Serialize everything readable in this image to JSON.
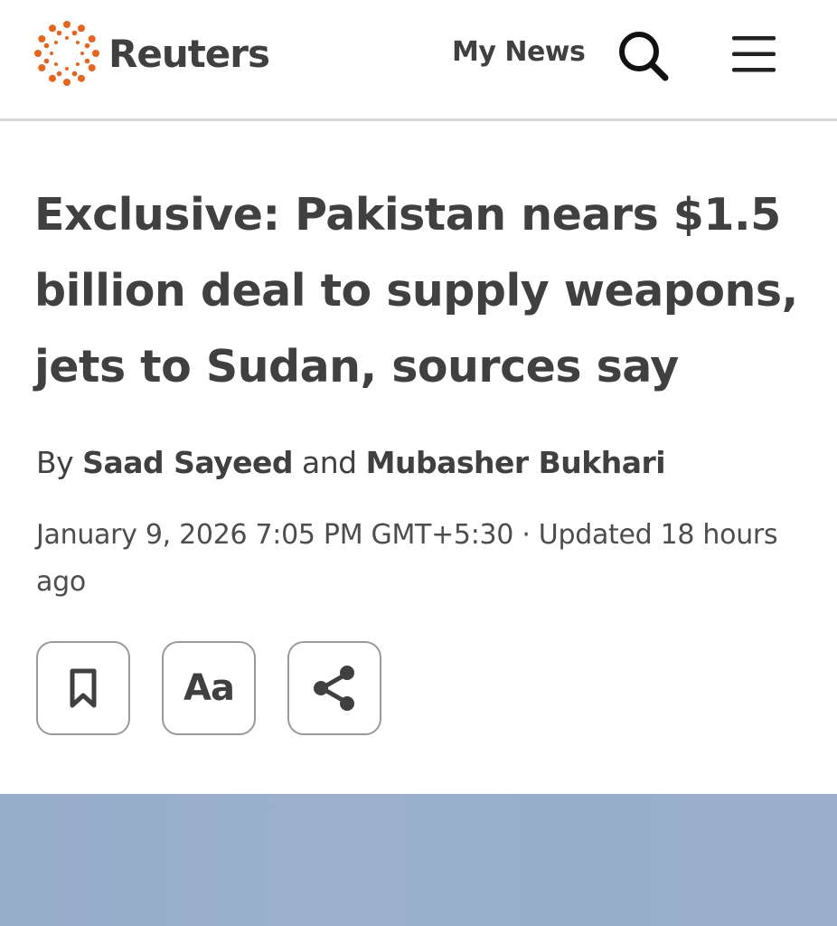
{
  "header": {
    "brand": "Reuters",
    "brand_color": "#e8631c",
    "my_news_label": "My News",
    "search_icon": "search-icon",
    "menu_icon": "hamburger-menu-icon"
  },
  "article": {
    "headline": "Exclusive: Pakistan nears $1.5 billion deal to supply weapons, jets to Sudan, sources say",
    "byline": {
      "prefix": "By",
      "author1": "Saad Sayeed",
      "joiner": "and",
      "author2": "Mubasher Bukhari"
    },
    "dateline": "January 9, 2026 7:05 PM GMT+5:30 · Updated 18 hours ago"
  },
  "actions": {
    "bookmark_icon": "bookmark-icon",
    "font_size_label": "Aa",
    "share_icon": "share-icon"
  },
  "colors": {
    "text": "#404040",
    "divider": "#d9d9d9",
    "hero_placeholder": "#98afcc"
  }
}
